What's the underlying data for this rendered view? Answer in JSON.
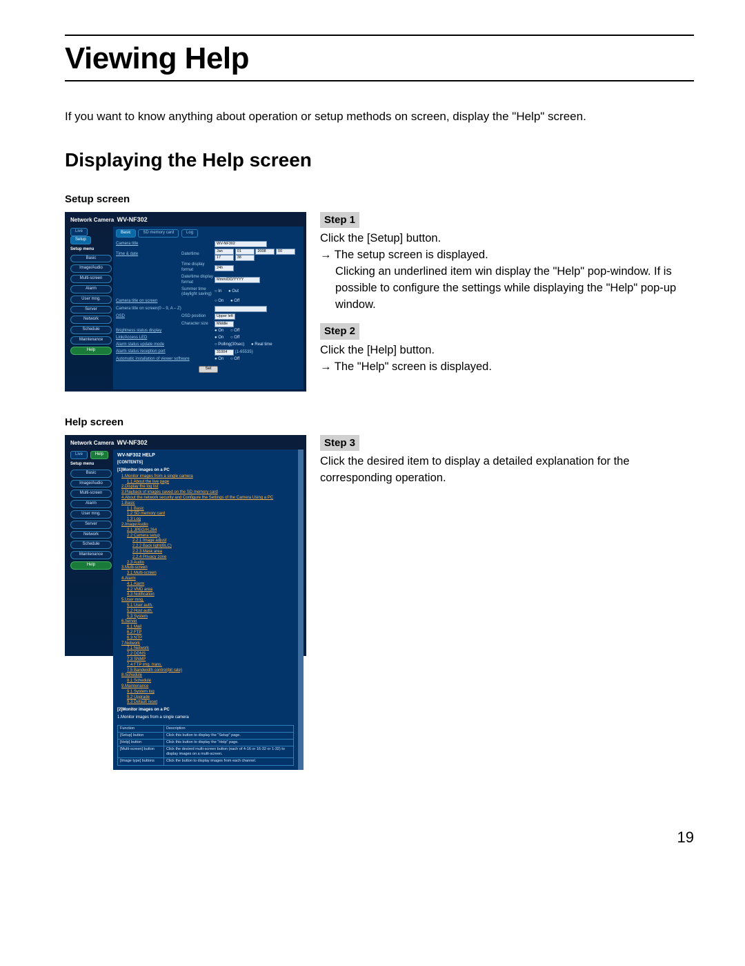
{
  "page": {
    "title": "Viewing Help",
    "intro": "If you want to know anything about operation or setup methods on screen, display the \"Help\" screen.",
    "subtitle": "Displaying the Help screen",
    "page_number": "19"
  },
  "labels": {
    "setup_screen": "Setup screen",
    "help_screen": "Help screen"
  },
  "steps": {
    "s1": {
      "chip": "Step 1",
      "line1": "Click the [Setup] button.",
      "line2": "→ The setup screen is displayed.",
      "line3": "Clicking an underlined item win display the \"Help\" pop-window. If is possible to configure the settings while displaying the \"Help\" pop-up window."
    },
    "s2": {
      "chip": "Step 2",
      "line1": "Click the [Help] button.",
      "line2": "→ The \"Help\" screen is displayed."
    },
    "s3": {
      "chip": "Step 3",
      "line1": "Click the desired item to display a detailed explanation for the corresponding operation."
    }
  },
  "setup_mock": {
    "brand": "Network Camera",
    "model": "WV-NF302",
    "live": "Live",
    "setup": "Setup",
    "side_head": "Setup menu",
    "side": [
      "Basic",
      "Image/Audio",
      "Multi-screen",
      "Alarm",
      "User mng.",
      "Server",
      "Network",
      "Schedule",
      "Maintenance",
      "Help"
    ],
    "tabs": [
      "Basic",
      "SD memory card",
      "Log"
    ],
    "camera_title_value": "WV-NF302",
    "rows": {
      "camera_title": "Camera title",
      "time_date": "Time & date",
      "date_time": "Date/time",
      "date_pick": {
        "mon": "Jan",
        "d": "01",
        "y": "2008",
        "hh": "00",
        "mm": "17",
        "ss": "38"
      },
      "time_format": "Time display format",
      "time_format_val": "24h",
      "dt_format": "Date/time display format",
      "dt_format_val": "Mmm/DD/YYYY",
      "summer": "Summer time (daylight saving)",
      "in": "In",
      "out": "Out",
      "on": "On",
      "off": "Off",
      "cam_title_screen": "Camera title on screen",
      "cam_title_chars": "Camera title on screen(0 – 9, A – Z)",
      "osd": "OSD",
      "osd_pos": "OSD position",
      "osd_pos_val": "Upper left",
      "char_size": "Character size",
      "char_size_val": "Middle",
      "bright": "Brightness status display",
      "link_led": "Link/Access LED",
      "alarm_update": "Alarm status update mode",
      "polling": "Polling(30sec)",
      "realtime": "Real time",
      "alarm_port": "Alarm status reception port",
      "alarm_port_val": "31004",
      "alarm_port_range": "(1-65535)",
      "auto_install": "Automatic installation of viewer software",
      "set": "Set"
    }
  },
  "help_mock": {
    "brand": "Network Camera",
    "model": "WV-NF302",
    "live": "Live",
    "help": "Help",
    "side_head": "Setup menu",
    "side": [
      "Basic",
      "Image/Audio",
      "Multi-screen",
      "Alarm",
      "User mng.",
      "Server",
      "Network",
      "Schedule",
      "Maintenance",
      "Help"
    ],
    "doc_title": "WV-NF302 HELP",
    "contents": "[CONTENTS]",
    "sec1": "[1]Monitor images on a PC",
    "links1": [
      "1.Monitor images from a single camera",
      "1.1 About the live page",
      "2.Display the log list",
      "3.Playback of images saved on the SD memory card",
      "4.About the network security and Configure the Settings of the Camera Using a PC"
    ],
    "links_basic": [
      "1.Basic",
      "1.1 Basic",
      "1.2 SD memory card",
      "1.3 Log"
    ],
    "links_image": [
      "2.Image/Audio",
      "2.1 JPEG/H.264",
      "2.2 Camera setup",
      "2.2.1 Image adjust",
      "2.2.2 Back light(BLC)",
      "2.2.3 Mask area",
      "2.2.4 Privacy zone",
      "2.3 Audio"
    ],
    "links_multi": [
      "3.Multi-screen",
      "3.1 Multi-screen"
    ],
    "links_alarm": [
      "4.Alarm",
      "4.1 Alarm",
      "4.2 VMD area",
      "4.3 Notification"
    ],
    "links_user": [
      "5.User mng.",
      "5.1 User auth.",
      "5.2 Host auth.",
      "5.3 System"
    ],
    "links_server": [
      "6.Server",
      "6.1 Mail",
      "6.2 FTP",
      "6.3 NTP"
    ],
    "links_network": [
      "7.Network",
      "7.1 Network",
      "7.2 DDNS",
      "7.3 SNMP",
      "7.4 FTP img. trans.",
      "7.5 Bandwidth control(bit rate)"
    ],
    "links_sched": [
      "8.Schedule",
      "8.1 Schedule"
    ],
    "links_maint": [
      "9.Maintenance",
      "9.1 System log",
      "9.2 Upgrade",
      "9.3 Default reset"
    ],
    "sec2": "[2]Monitor images on a PC",
    "sec2sub": "1.Monitor images from a single camera",
    "table_h1": "Function",
    "table_h2": "Description",
    "table": [
      [
        "[Setup] button",
        "Click this button to display the \"Setup\" page."
      ],
      [
        "[Help] button",
        "Click this button to display the \"Help\" page."
      ],
      [
        "[Multi-screen] button",
        "Click the desired multi-screen button (each of 4-16 or 16-32 or 1-32) to display images on a multi-screen."
      ],
      [
        "[Image type] buttons",
        "Click the button to display images from each channel."
      ]
    ]
  }
}
